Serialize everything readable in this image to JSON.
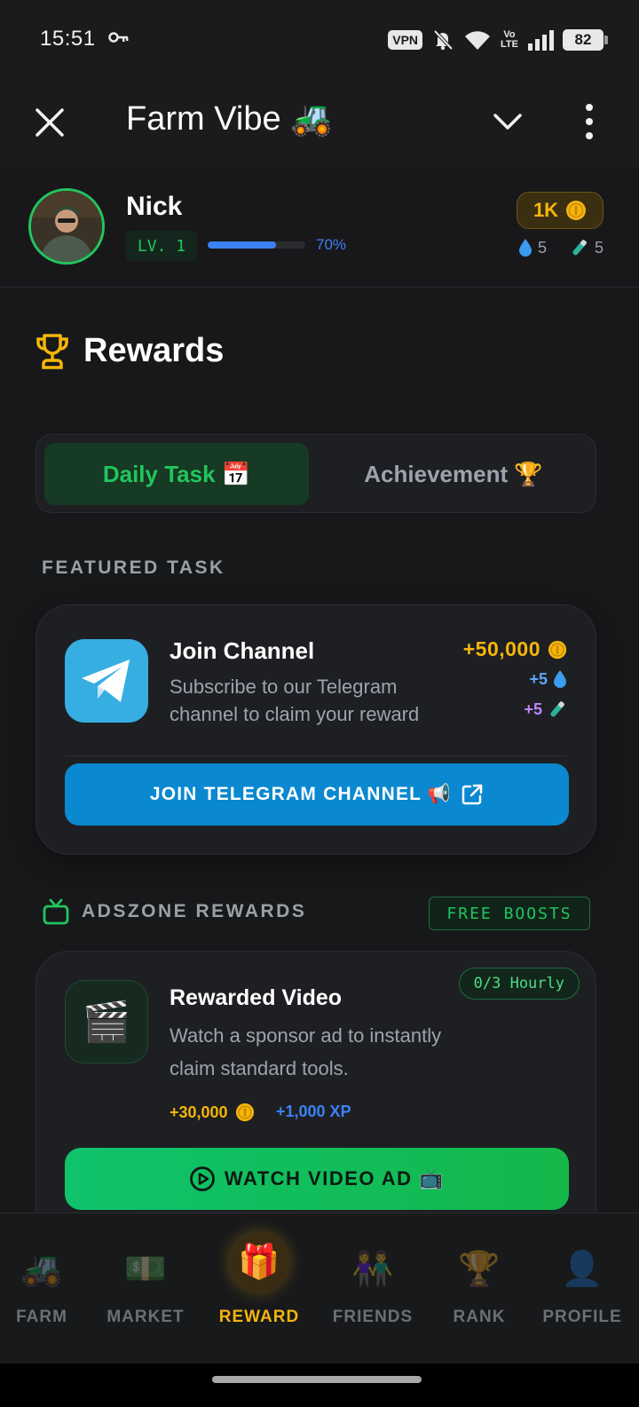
{
  "status_bar": {
    "time": "15:51",
    "vpn": "VPN",
    "volte_top": "Vo",
    "volte_bottom": "LTE",
    "battery": "82"
  },
  "app_bar": {
    "title": "Farm Vibe 🚜"
  },
  "profile": {
    "name": "Nick",
    "level": "LV. 1",
    "xp_percent_label": "70%",
    "xp_fraction": 0.7,
    "coins": "1K",
    "water_count": "5",
    "potion_count": "5"
  },
  "rewards": {
    "title": "Rewards"
  },
  "tabs": {
    "daily": "Daily Task 📅",
    "achievement": "Achievement 🏆"
  },
  "featured": {
    "section_label": "FEATURED TASK",
    "title": "Join Channel",
    "description": "Subscribe to our Telegram channel to claim your reward",
    "reward_coins": "+50,000",
    "reward_water": "+5",
    "reward_potion": "+5",
    "button_label": "JOIN TELEGRAM CHANNEL 📢"
  },
  "adszone": {
    "section_label": "ADSZONE REWARDS",
    "badge": "FREE BOOSTS",
    "card": {
      "title": "Rewarded Video",
      "description": "Watch a sponsor ad to instantly claim standard tools.",
      "limit": "0/3 Hourly",
      "reward_coins": "+30,000",
      "reward_xp": "+1,000 XP",
      "button_label": "WATCH VIDEO AD 📺"
    }
  },
  "bottom_nav": [
    {
      "label": "FARM",
      "icon": "🚜"
    },
    {
      "label": "MARKET",
      "icon": "💵"
    },
    {
      "label": "REWARD",
      "icon": "🎁"
    },
    {
      "label": "FRIENDS",
      "icon": "👫"
    },
    {
      "label": "RANK",
      "icon": "🏆"
    },
    {
      "label": "PROFILE",
      "icon": "👤"
    }
  ],
  "colors": {
    "background": "#17181a",
    "accent_green": "#22c55e",
    "accent_gold": "#f5b50a",
    "accent_blue": "#3b82f6",
    "telegram_blue": "#0a88d0"
  }
}
